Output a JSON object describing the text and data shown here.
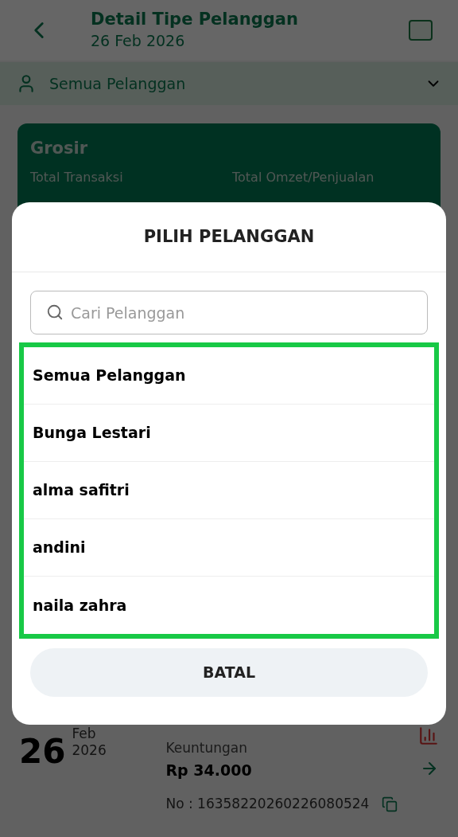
{
  "header": {
    "title": "Detail Tipe Pelanggan",
    "subtitle": "26 Feb 2026"
  },
  "filter": {
    "label": "Semua Pelanggan"
  },
  "summary_card": {
    "title": "Grosir",
    "label_1": "Total Transaksi",
    "label_2": "Total Omzet/Penjualan"
  },
  "transaction": {
    "day": "26",
    "month": "Feb",
    "year": "2026",
    "label": "Keuntungan",
    "amount": "Rp 34.000",
    "number": "No : 16358220260226080524"
  },
  "dialog": {
    "title": "PILIH PELANGGAN",
    "search": {
      "placeholder": "Cari Pelanggan"
    },
    "options": [
      {
        "label": "Semua Pelanggan"
      },
      {
        "label": "Bunga Lestari"
      },
      {
        "label": "alma safitri"
      },
      {
        "label": "andini"
      },
      {
        "label": "naila zahra"
      }
    ],
    "cancel": "BATAL"
  }
}
